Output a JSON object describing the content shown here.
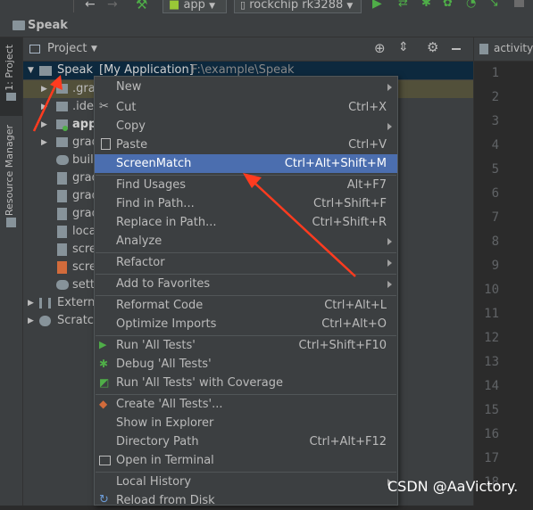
{
  "toolbar": {
    "run_config": "app",
    "device": "rockchip rk3288"
  },
  "breadcrumb": {
    "project_name": "Speak"
  },
  "left_tabs": {
    "project_tab": "1: Project",
    "resource_manager_tab": "Resource Manager"
  },
  "panel": {
    "title": "Project"
  },
  "editor": {
    "tab_label": "activity_",
    "line_numbers": [
      "1",
      "2",
      "3",
      "4",
      "5",
      "6",
      "7",
      "8",
      "9",
      "10",
      "11",
      "12",
      "13",
      "14",
      "15",
      "16",
      "17",
      "18"
    ]
  },
  "tree": {
    "root_name": "Speak",
    "root_module": "[My Application]",
    "root_path": "F:\\example\\Speak",
    "items": [
      ".gra",
      ".idea",
      "app",
      "grad",
      "build",
      "grad",
      "grad",
      "grad",
      "local",
      "scre",
      "scre",
      "setti"
    ],
    "external": "External",
    "scratches": "Scratche"
  },
  "menu": {
    "new": "New",
    "cut": "Cut",
    "cut_sc": "Ctrl+X",
    "copy": "Copy",
    "paste": "Paste",
    "paste_sc": "Ctrl+V",
    "screenmatch": "ScreenMatch",
    "screenmatch_sc": "Ctrl+Alt+Shift+M",
    "find_usages": "Find Usages",
    "find_usages_sc": "Alt+F7",
    "find_in_path": "Find in Path...",
    "find_in_path_sc": "Ctrl+Shift+F",
    "replace_in_path": "Replace in Path...",
    "replace_in_path_sc": "Ctrl+Shift+R",
    "analyze": "Analyze",
    "refactor": "Refactor",
    "add_to_favorites": "Add to Favorites",
    "reformat_code": "Reformat Code",
    "reformat_code_sc": "Ctrl+Alt+L",
    "optimize_imports": "Optimize Imports",
    "optimize_imports_sc": "Ctrl+Alt+O",
    "run_all_tests": "Run 'All Tests'",
    "run_all_tests_sc": "Ctrl+Shift+F10",
    "debug_all_tests": "Debug 'All Tests'",
    "run_with_coverage": "Run 'All Tests' with Coverage",
    "create_all_tests": "Create 'All Tests'...",
    "show_in_explorer": "Show in Explorer",
    "directory_path": "Directory Path",
    "directory_path_sc": "Ctrl+Alt+F12",
    "open_in_terminal": "Open in Terminal",
    "local_history": "Local History",
    "reload_from_disk": "Reload from Disk"
  },
  "watermark": "CSDN @AaVictory.",
  "colors": {
    "highlight": "#4b6eaf",
    "annotation_arrow": "#ff3b1f"
  }
}
